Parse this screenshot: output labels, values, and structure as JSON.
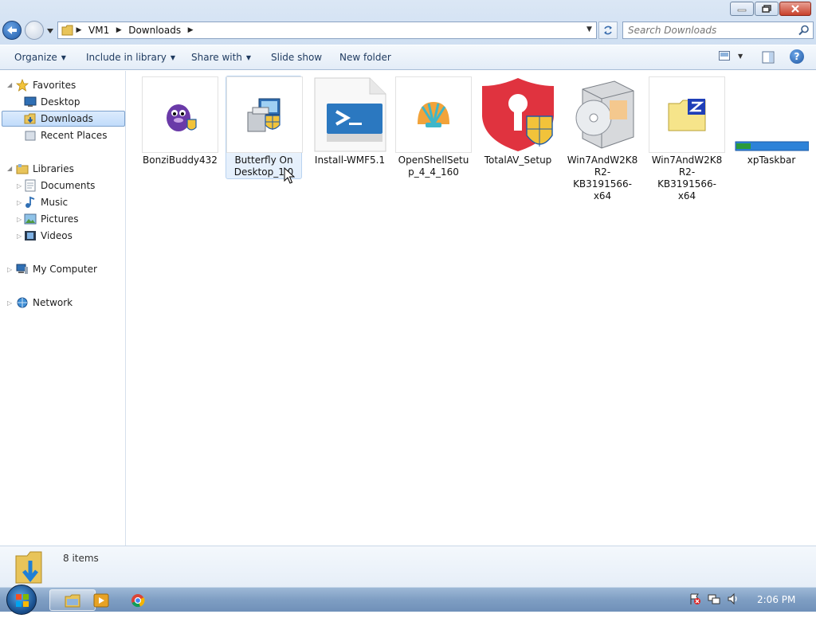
{
  "window": {
    "buttons": {
      "minimize": "minimize",
      "restore": "restore",
      "close": "close"
    }
  },
  "address": {
    "crumbs": [
      "VM1",
      "Downloads"
    ],
    "search_placeholder": "Search Downloads"
  },
  "toolbar": {
    "organize": "Organize",
    "include_in_library": "Include in library",
    "share_with": "Share with",
    "slide_show": "Slide show",
    "new_folder": "New folder"
  },
  "nav": {
    "favorites": "Favorites",
    "desktop": "Desktop",
    "downloads": "Downloads",
    "recent_places": "Recent Places",
    "libraries": "Libraries",
    "documents": "Documents",
    "music": "Music",
    "pictures": "Pictures",
    "videos": "Videos",
    "my_computer": "My Computer",
    "network": "Network"
  },
  "files": [
    {
      "name": "BonziBuddy432",
      "icon": "bonzi-setup-icon"
    },
    {
      "name": "Butterfly On Desktop_1.0",
      "icon": "installer-shield-icon"
    },
    {
      "name": "Install-WMF5.1",
      "icon": "powershell-icon"
    },
    {
      "name": "OpenShellSetup_4_4_160",
      "icon": "shell-icon"
    },
    {
      "name": "TotalAV_Setup",
      "icon": "totalav-shield-icon"
    },
    {
      "name": "Win7AndW2K8R2-KB3191566-x64",
      "icon": "msu-box-icon"
    },
    {
      "name": "Win7AndW2K8R2-KB3191566-x64",
      "icon": "zip-folder-icon"
    },
    {
      "name": "xpTaskbar",
      "icon": "taskbar-image-icon"
    }
  ],
  "details": {
    "count": "8 items"
  },
  "taskbar": {
    "clock": "2:06 PM"
  },
  "colors": {
    "accent": "#1f5aa6",
    "selection": "#c1dcfb",
    "taskbar": "#7f9ec3"
  }
}
